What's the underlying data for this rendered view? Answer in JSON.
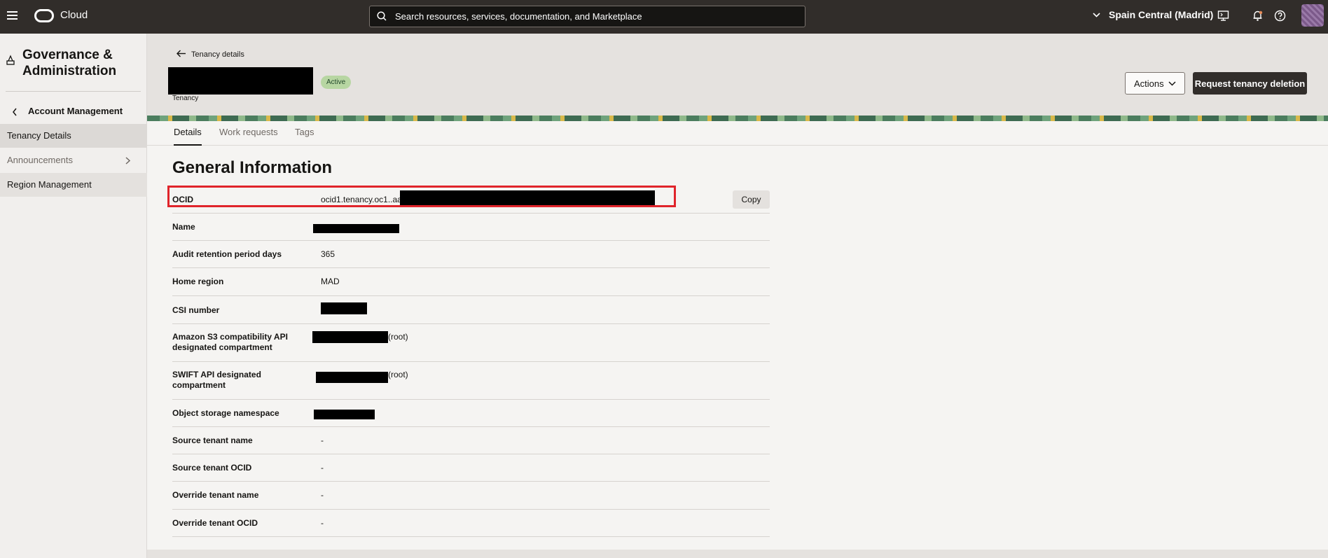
{
  "topbar": {
    "brand": "Cloud",
    "search_placeholder": "Search resources, services, documentation, and Marketplace",
    "region": "Spain Central (Madrid)"
  },
  "sidebar": {
    "title": "Governance & Administration",
    "back_label": "Account Management",
    "items": [
      {
        "label": "Tenancy Details"
      },
      {
        "label": "Announcements"
      },
      {
        "label": "Region Management"
      }
    ]
  },
  "header": {
    "breadcrumb": "Tenancy details",
    "status": "Active",
    "subtitle": "Tenancy",
    "actions_label": "Actions",
    "delete_label": "Request tenancy deletion"
  },
  "tabs": [
    "Details",
    "Work requests",
    "Tags"
  ],
  "general_info": {
    "title": "General Information",
    "copy_label": "Copy",
    "rows": [
      {
        "label": "OCID",
        "value": "ocid1.tenancy.oc1..aa"
      },
      {
        "label": "Name",
        "value": ""
      },
      {
        "label": "Audit retention period days",
        "value": "365"
      },
      {
        "label": "Home region",
        "value": "MAD"
      },
      {
        "label": "CSI number",
        "value": ""
      },
      {
        "label": "Amazon S3 compatibility API designated compartment",
        "value": "(root)"
      },
      {
        "label": "SWIFT API designated compartment",
        "value": "(root)"
      },
      {
        "label": "Object storage namespace",
        "value": ""
      },
      {
        "label": "Source tenant name",
        "value": "-"
      },
      {
        "label": "Source tenant OCID",
        "value": "-"
      },
      {
        "label": "Override tenant name",
        "value": "-"
      },
      {
        "label": "Override tenant OCID",
        "value": "-"
      }
    ]
  }
}
